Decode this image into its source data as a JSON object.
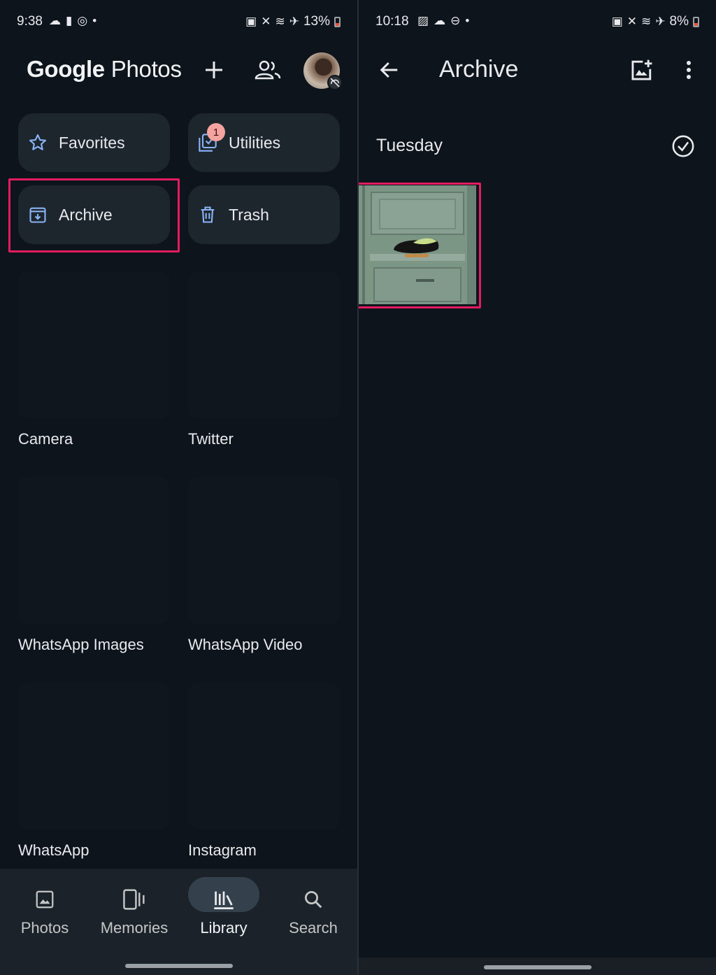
{
  "left": {
    "status": {
      "time": "9:38",
      "battery": "13%"
    },
    "header": {
      "logo_google": "Google",
      "logo_photos": "Photos"
    },
    "chips": [
      {
        "label": "Favorites",
        "icon": "star-icon"
      },
      {
        "label": "Utilities",
        "icon": "utilities-icon",
        "badge": "1"
      },
      {
        "label": "Archive",
        "icon": "archive-icon"
      },
      {
        "label": "Trash",
        "icon": "trash-icon"
      }
    ],
    "albums": [
      "Camera",
      "Twitter",
      "WhatsApp Images",
      "WhatsApp Video",
      "WhatsApp",
      "Instagram"
    ],
    "nav": [
      {
        "label": "Photos",
        "icon": "photo-icon"
      },
      {
        "label": "Memories",
        "icon": "memories-icon"
      },
      {
        "label": "Library",
        "icon": "library-icon",
        "active": true
      },
      {
        "label": "Search",
        "icon": "search-icon"
      }
    ]
  },
  "right": {
    "status": {
      "time": "10:18",
      "battery": "8%"
    },
    "title": "Archive",
    "section": "Tuesday"
  },
  "colors": {
    "highlight": "#e31c5f",
    "accent": "#8ab4f8",
    "background": "#0e141b"
  }
}
